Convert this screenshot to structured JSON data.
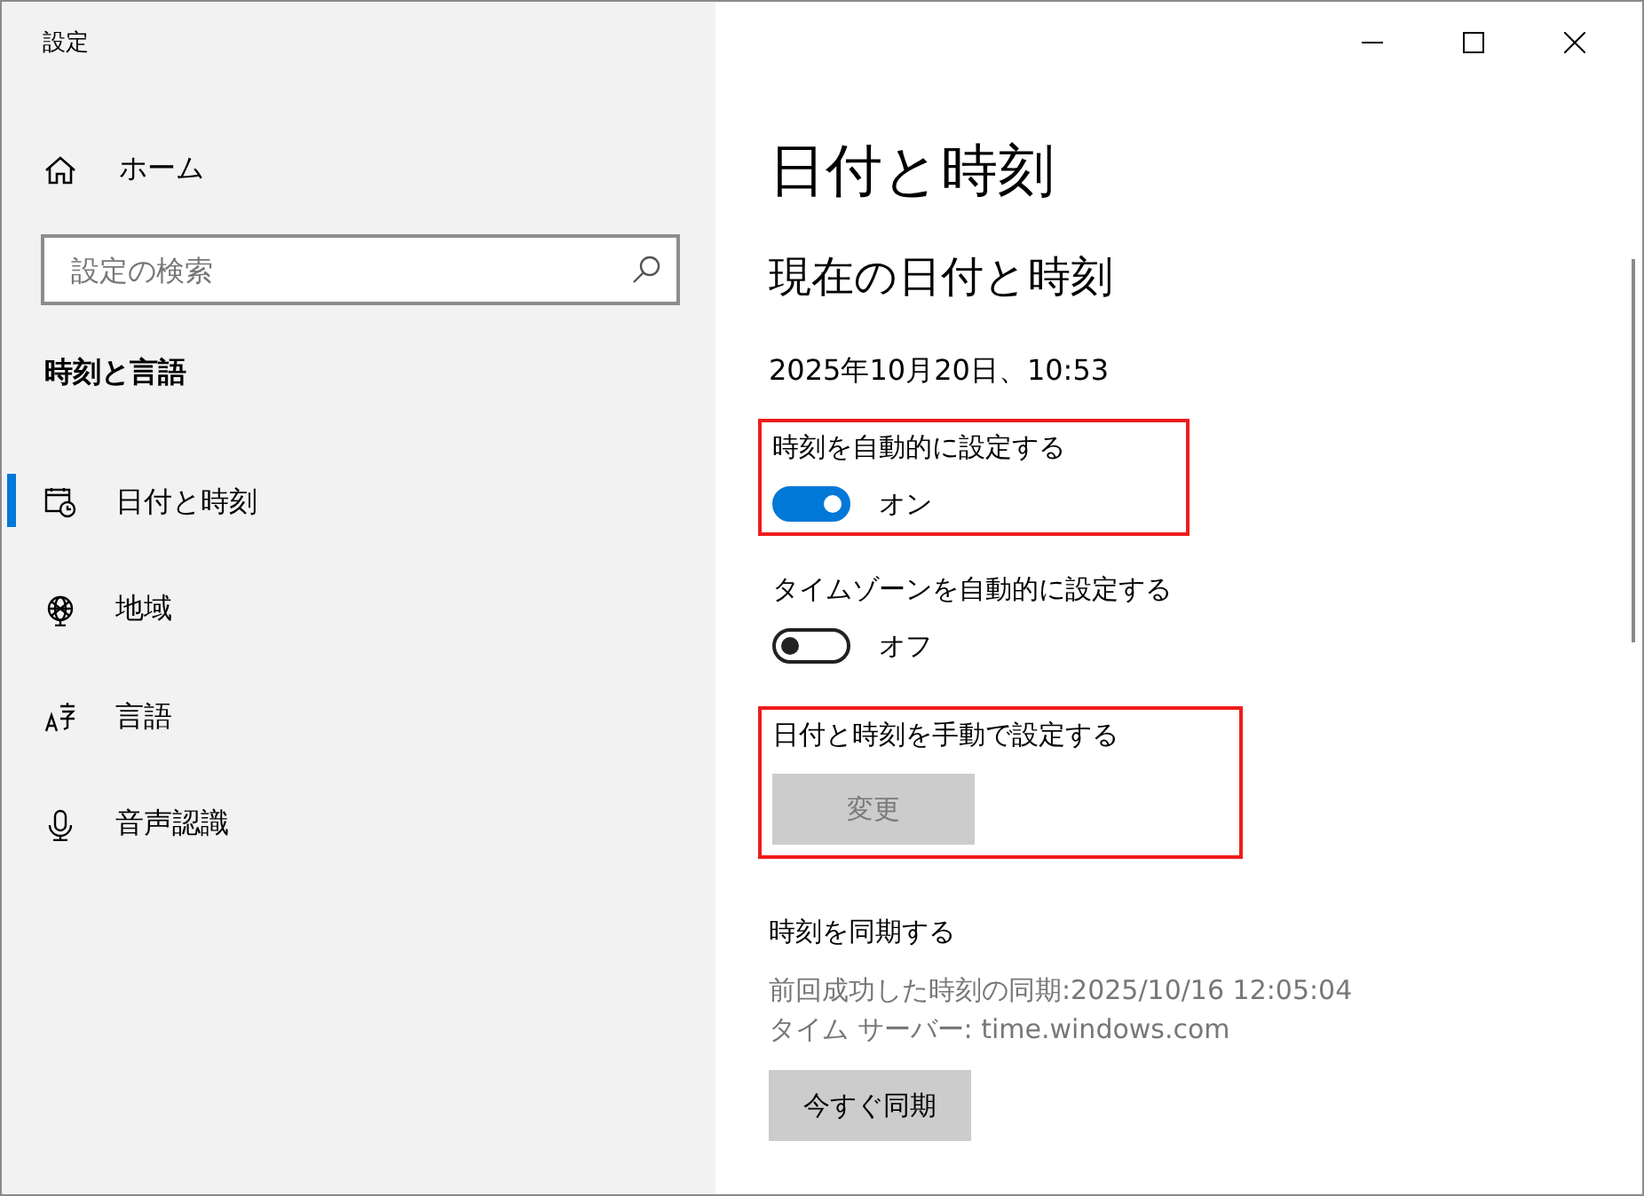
{
  "window": {
    "title": "設定"
  },
  "sidebar": {
    "home": "ホーム",
    "search": {
      "placeholder": "設定の検索"
    },
    "section": "時刻と言語",
    "items": [
      {
        "label": "日付と時刻",
        "kind": "calendar",
        "selected": true
      },
      {
        "label": "地域",
        "kind": "globe",
        "selected": false
      },
      {
        "label": "言語",
        "kind": "language",
        "selected": false
      },
      {
        "label": "音声認識",
        "kind": "microphone",
        "selected": false
      }
    ]
  },
  "main": {
    "title": "日付と時刻",
    "subtitle": "現在の日付と時刻",
    "current": "2025年10月20日、10:53",
    "settings": [
      {
        "kind": "toggle",
        "label": "時刻を自動的に設定する",
        "on": true,
        "state_text": "オン",
        "highlighted": true
      },
      {
        "kind": "toggle",
        "label": "タイムゾーンを自動的に設定する",
        "on": false,
        "state_text": "オフ",
        "highlighted": false
      },
      {
        "kind": "button",
        "label": "日付と時刻を手動で設定する",
        "button": "変更",
        "disabled": true,
        "highlighted": true
      }
    ],
    "sync": {
      "heading": "時刻を同期する",
      "details": [
        "前回成功した時刻の同期:2025/10/16 12:05:04",
        "タイム サーバー: time.windows.com"
      ],
      "button": "今すぐ同期",
      "disabled": false
    }
  }
}
